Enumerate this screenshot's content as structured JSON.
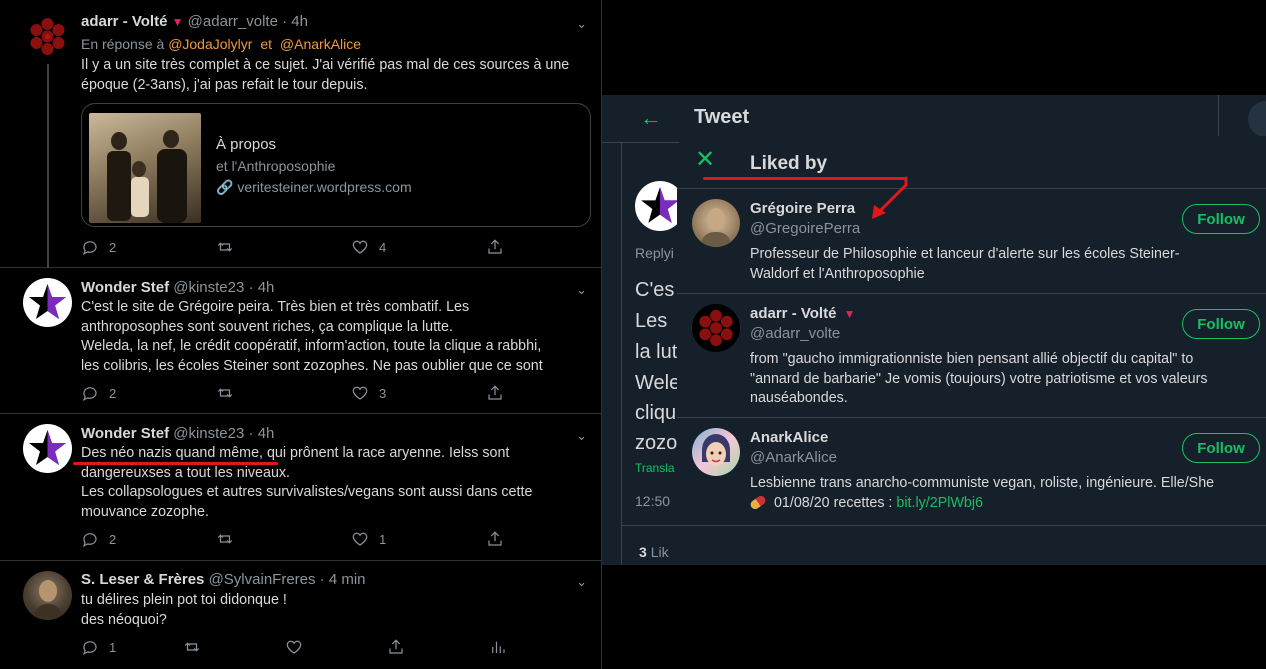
{
  "feed": {
    "tweets": [
      {
        "name": "adarr - Volté",
        "handle": "@adarr_volte",
        "time": "4h",
        "reply_label": "En réponse à",
        "reply_to_1": "@JodaJolylyr",
        "reply_and": "et",
        "reply_to_2": "@AnarkAlice",
        "text": "Il y a un site très complet à ce sujet. J'ai vérifié pas mal de ces sources à une époque (2-3ans), j'ai pas refait le tour depuis.",
        "card": {
          "title": "À propos",
          "subtitle": "et l'Anthroposophie",
          "url": "veritesteiner.wordpress.com"
        },
        "replies": "2",
        "retweets": "",
        "likes": "4"
      },
      {
        "name": "Wonder Stef",
        "handle": "@kinste23",
        "time": "4h",
        "text_lines": [
          "C'est le site de Grégoire peira. Très bien et très combatif. Les",
          "anthroposophes sont souvent riches, ça complique la lutte.",
          "Weleda, la nef, le crédit coopératif, inform'action, toute la clique a rabbhi,",
          "les colibris, les écoles Steiner sont zozophes. Ne pas oublier que ce sont"
        ],
        "replies": "2",
        "retweets": "",
        "likes": "3"
      },
      {
        "name": "Wonder Stef",
        "handle": "@kinste23",
        "time": "4h",
        "text_lines": [
          "Des néo nazis quand même, qui prônent la race aryenne. Ielss sont",
          "dangereuxses a tout les niveaux.",
          "Les collapsologues et autres survivalistes/vegans sont aussi dans cette",
          "mouvance zozophe."
        ],
        "replies": "2",
        "retweets": "",
        "likes": "1"
      },
      {
        "name": "S. Leser & Frères",
        "handle": "@SylvainFreres",
        "time": "4 min",
        "text_lines": [
          "tu délires plein pot toi didonque !",
          "des néoquoi?"
        ],
        "replies": "1",
        "retweets": "",
        "likes": ""
      }
    ]
  },
  "back_panel": {
    "title": "Tweet",
    "replying": "Replyi",
    "snippets": [
      "C'es",
      "Les",
      "la lut",
      "Wele",
      "cliqu",
      "zozo"
    ],
    "translate": "Transla",
    "time": "12:50",
    "likes_count": "3",
    "likes_label": "Lik"
  },
  "modal": {
    "title": "Liked by",
    "users": [
      {
        "name": "Grégoire Perra",
        "handle": "@GregoirePerra",
        "follow_label": "Follow",
        "bio_lines": [
          "Professeur de Philosophie et lanceur d'alerte sur les écoles Steiner-",
          "Waldorf et l'Anthroposophie"
        ]
      },
      {
        "name": "adarr - Volté",
        "handle": "@adarr_volte",
        "follow_label": "Follow",
        "bio_lines": [
          "from \"gaucho immigrationniste bien pensant allié objectif du capital\" to",
          "\"annard de barbarie\" Je vomis (toujours) votre patriotisme et vos valeurs",
          "nauséabondes."
        ]
      },
      {
        "name": "AnarkAlice",
        "handle": "@AnarkAlice",
        "follow_label": "Follow",
        "bio_line1": "Lesbienne trans anarcho-communiste vegan, roliste, ingénieure. Elle/She",
        "bio_line2_prefix": "01/08/20 recettes :",
        "bio_link": "bit.ly/2PlWbj6"
      }
    ]
  },
  "colors": {
    "accent": "#17bf63",
    "mention": "#f29a3a",
    "annotation": "#e0181a",
    "background": "#000000",
    "panel": "#15202b"
  }
}
